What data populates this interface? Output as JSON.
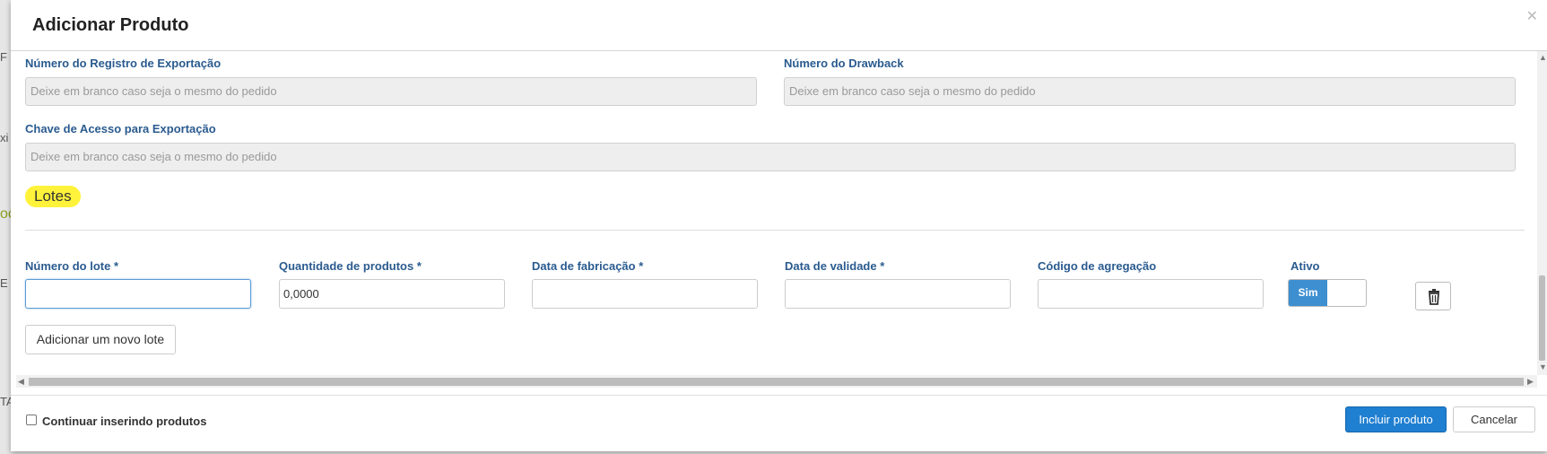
{
  "background": {
    "fragments": [
      "F",
      "xi",
      "oc",
      "E",
      "TA"
    ]
  },
  "modal": {
    "title": "Adicionar Produto",
    "close_icon": "close-icon"
  },
  "export_fields": {
    "registro_label": "Número do Registro de Exportação",
    "registro_placeholder": "Deixe em branco caso seja o mesmo do pedido",
    "drawback_label": "Número do Drawback",
    "drawback_placeholder": "Deixe em branco caso seja o mesmo do pedido",
    "chave_label": "Chave de Acesso para Exportação",
    "chave_placeholder": "Deixe em branco caso seja o mesmo do pedido"
  },
  "lotes": {
    "title": "Lotes",
    "columns": {
      "numero": "Número do lote *",
      "quantidade": "Quantidade de produtos *",
      "fabricacao": "Data de fabricação *",
      "validade": "Data de validade *",
      "codigo": "Código de agregação",
      "ativo": "Ativo"
    },
    "row": {
      "numero": "",
      "quantidade": "0,0000",
      "fabricacao": "",
      "validade": "",
      "codigo": "",
      "ativo_label": "Sim",
      "ativo_on": true
    },
    "add_button": "Adicionar um novo lote"
  },
  "footer": {
    "continue_label": "Continuar inserindo produtos",
    "continue_checked": false,
    "submit_button": "Incluir produto",
    "cancel_button": "Cancelar"
  },
  "colors": {
    "label": "#2a5b8f",
    "primary": "#1f7fd1",
    "highlight": "#fff23a",
    "toggle_on": "#3d8fd0"
  }
}
